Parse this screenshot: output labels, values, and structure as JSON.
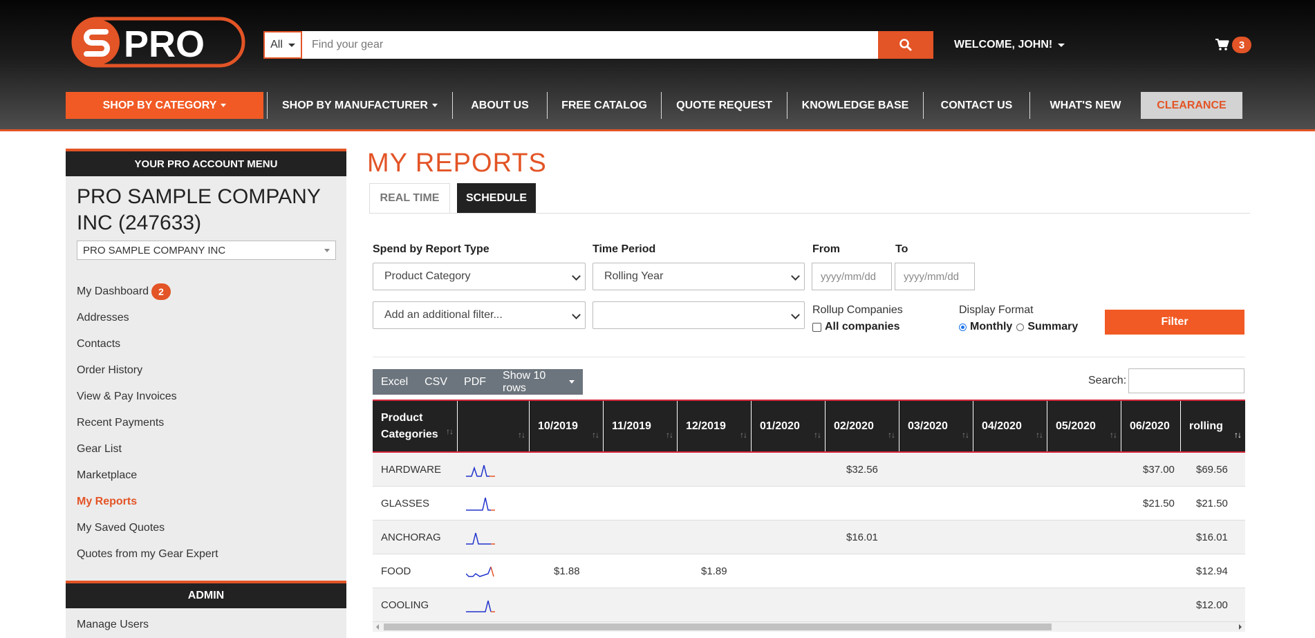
{
  "header": {
    "logo_text": "PRO",
    "search_category": "All",
    "search_placeholder": "Find your gear",
    "welcome": "WELCOME, JOHN!",
    "cart_count": "3",
    "brand_color": "#e35426"
  },
  "nav": {
    "items": [
      {
        "label": "SHOP BY CATEGORY"
      },
      {
        "label": "SHOP BY MANUFACTURER"
      },
      {
        "label": "ABOUT US"
      },
      {
        "label": "FREE CATALOG"
      },
      {
        "label": "QUOTE REQUEST"
      },
      {
        "label": "KNOWLEDGE BASE"
      },
      {
        "label": "CONTACT US"
      },
      {
        "label": "WHAT'S NEW"
      },
      {
        "label": "CLEARANCE"
      }
    ]
  },
  "sidebar": {
    "title": "YOUR PRO ACCOUNT MENU",
    "company_name": "PRO SAMPLE COMPANY INC (247633)",
    "company_select": "PRO SAMPLE COMPANY INC",
    "links": [
      {
        "label": "My Dashboard",
        "badge": "2"
      },
      {
        "label": "Addresses"
      },
      {
        "label": "Contacts"
      },
      {
        "label": "Order History"
      },
      {
        "label": "View & Pay Invoices"
      },
      {
        "label": "Recent Payments"
      },
      {
        "label": "Gear List"
      },
      {
        "label": "Marketplace"
      },
      {
        "label": "My Reports"
      },
      {
        "label": "My Saved Quotes"
      },
      {
        "label": "Quotes from my Gear Expert"
      }
    ],
    "admin_title": "ADMIN",
    "admin_link": "Manage Users"
  },
  "main": {
    "title": "MY REPORTS",
    "tabs": [
      {
        "label": "REAL TIME"
      },
      {
        "label": "SCHEDULE"
      }
    ],
    "filters": {
      "report_type_label": "Spend by Report Type",
      "report_type_value": "Product Category",
      "time_period_label": "Time Period",
      "time_period_value": "Rolling Year",
      "from_label": "From",
      "to_label": "To",
      "date_placeholder": "yyyy/mm/dd",
      "additional_filter": "Add an additional filter...",
      "rollup_label": "Rollup Companies",
      "all_companies": "All companies",
      "display_label": "Display Format",
      "monthly": "Monthly",
      "summary": "Summary",
      "filter_button": "Filter"
    },
    "exports": {
      "excel": "Excel",
      "csv": "CSV",
      "pdf": "PDF",
      "rows": "Show 10 rows"
    },
    "search_label": "Search:",
    "table": {
      "headers": [
        "Product Categories",
        "",
        "10/2019",
        "11/2019",
        "12/2019",
        "01/2020",
        "02/2020",
        "03/2020",
        "04/2020",
        "05/2020",
        "06/2020",
        "rolling"
      ],
      "rows": [
        {
          "category": "HARDWARE",
          "c10_2019": "",
          "c12_2019": "",
          "c02_2020": "$32.56",
          "c06_2020": "$37.00",
          "rolling": "$69.56"
        },
        {
          "category": "GLASSES",
          "c10_2019": "",
          "c12_2019": "",
          "c02_2020": "",
          "c06_2020": "$21.50",
          "rolling": "$21.50"
        },
        {
          "category": "ANCHORAG",
          "c10_2019": "",
          "c12_2019": "",
          "c02_2020": "$16.01",
          "c06_2020": "",
          "rolling": "$16.01"
        },
        {
          "category": "FOOD",
          "c10_2019": "$1.88",
          "c12_2019": "$1.89",
          "c02_2020": "",
          "c06_2020": "",
          "rolling": "$12.94"
        },
        {
          "category": "COOLING",
          "c10_2019": "",
          "c12_2019": "",
          "c02_2020": "",
          "c06_2020": "",
          "rolling": "$12.00"
        }
      ]
    }
  }
}
